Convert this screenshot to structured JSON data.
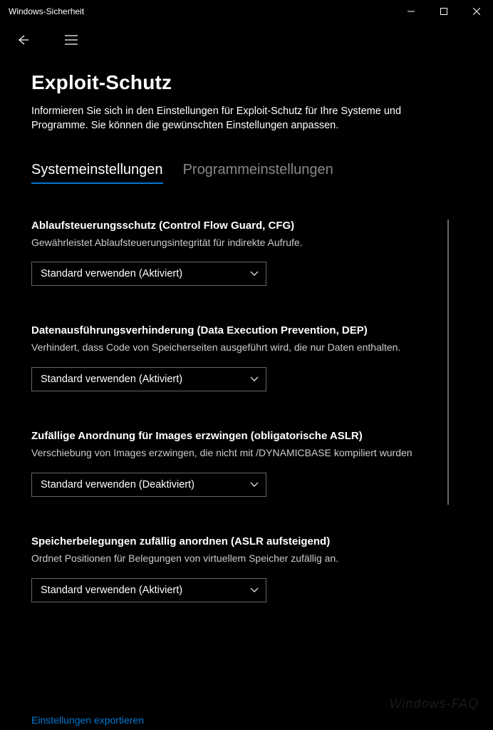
{
  "window": {
    "title": "Windows-Sicherheit"
  },
  "page": {
    "title": "Exploit-Schutz",
    "description": "Informieren Sie sich in den Einstellungen für Exploit-Schutz für Ihre Systeme und Programme. Sie können die gewünschten Einstellungen anpassen."
  },
  "tabs": {
    "system": "Systemeinstellungen",
    "program": "Programmeinstellungen"
  },
  "settings": [
    {
      "title": "Ablaufsteuerungsschutz (Control Flow Guard, CFG)",
      "desc": "Gewährleistet Ablaufsteuerungsintegrität für indirekte Aufrufe.",
      "value": "Standard verwenden (Aktiviert)"
    },
    {
      "title": "Datenausführungsverhinderung (Data Execution Prevention, DEP)",
      "desc": "Verhindert, dass Code von Speicherseiten ausgeführt wird, die nur Daten enthalten.",
      "value": "Standard verwenden (Aktiviert)"
    },
    {
      "title": "Zufällige Anordnung für Images erzwingen (obligatorische ASLR)",
      "desc": "Verschiebung von Images erzwingen, die nicht mit /DYNAMICBASE kompiliert wurden",
      "value": "Standard verwenden (Deaktiviert)"
    },
    {
      "title": "Speicherbelegungen zufällig anordnen (ASLR aufsteigend)",
      "desc": "Ordnet Positionen für Belegungen von virtuellem Speicher zufällig an.",
      "value": "Standard verwenden (Aktiviert)"
    }
  ],
  "exportLink": "Einstellungen exportieren",
  "watermark": "Windows-FAQ"
}
